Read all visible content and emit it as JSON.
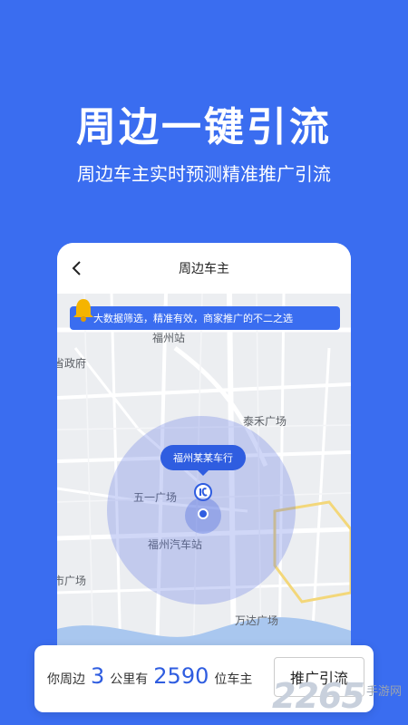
{
  "hero": {
    "title": "周边一键引流",
    "subtitle": "周边车主实时预测精准推广引流"
  },
  "phone": {
    "nav": {
      "title": "周边车主",
      "back_icon": "chevron-left-icon"
    },
    "notice": {
      "text": "大数据筛选，精准有效，商家推广的不二之选",
      "icon": "bell-icon"
    },
    "map": {
      "places": {
        "fuzhou_station": "福州站",
        "province_gov": "省政府",
        "taihe_plaza": "泰禾广场",
        "wuyi_plaza": "五一广场",
        "fuzhou_bus_station": "福州汽车站",
        "city_plaza": "市广场",
        "wanda_plaza": "万达广场"
      },
      "shop_label": "福州某某车行"
    }
  },
  "bottom_card": {
    "prefix": "你周边",
    "distance": "3",
    "middle": "公里有",
    "count": "2590",
    "suffix": "位车主",
    "button_label": "推广引流"
  },
  "watermark": {
    "number": "2265",
    "text": "手游网"
  },
  "colors": {
    "brand_blue": "#3a6df0",
    "accent_blue": "#2f5de0"
  }
}
